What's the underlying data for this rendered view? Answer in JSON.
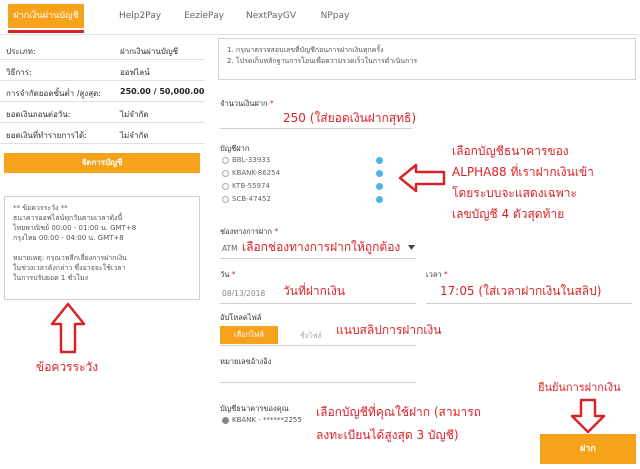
{
  "tabs": [
    {
      "label": "ฝากเงินผ่านบัญชี",
      "active": true
    },
    {
      "label": "Help2Pay",
      "active": false
    },
    {
      "label": "EeziePay",
      "active": false
    },
    {
      "label": "NextPayGV",
      "active": false
    },
    {
      "label": "NPpay",
      "active": false
    }
  ],
  "info": {
    "rows": [
      {
        "label": "ประเภท:",
        "value": "ฝากเงินผ่านบัญชี"
      },
      {
        "label": "วิธีการ:",
        "value": "ออฟไลน์"
      },
      {
        "label": "การจำกัดยอดขั้นต่ำ /สูงสุด:",
        "value": "250.00 / 50,000.00"
      },
      {
        "label": "ยอดเงินถอนต่อวัน:",
        "value": "ไม่จำกัด"
      },
      {
        "label": "ยอดเงินที่ทำรายการได้:",
        "value": "ไม่จำกัด"
      }
    ],
    "manage_button": "จัดการบัญชี"
  },
  "notice": {
    "lines": [
      "** ข้อควรระวัง **",
      "ธนาคารออฟไลน์ทุกวันตามเวลาดังนี้",
      "ไทยพาณิชย์ 00:00 - 01:00 น. GMT+8",
      "กรุงไทย 00:00 - 04:00 น. GMT+8",
      "",
      "หมายเหตุ: กรุณาหลีกเลี่ยงการฝากเงิน",
      "ในช่วงเวลาดังกล่าว ซึ่งอาจจะใช้เวลา",
      "ในการปรับยอด 1 ชั่วโมง"
    ]
  },
  "instructions": [
    "1. กรุณาตรวจสอบเลขที่บัญชีก่อนการฝากเงินทุกครั้ง",
    "2. โปรดเก็บหลักฐานการโอนเพื่อความรวดเร็วในการดำเนินการ"
  ],
  "form": {
    "amount_label": "จำนวนเงินฝาก",
    "required_mark": "*",
    "deposit_account_label": "บัญชีฝาก",
    "accounts": [
      {
        "label": "BBL-33933",
        "selected": false
      },
      {
        "label": "KBANK-86254",
        "selected": false
      },
      {
        "label": "KTB-55974",
        "selected": false
      },
      {
        "label": "SCB-47452",
        "selected": false
      }
    ],
    "channel_label": "ช่องทางการฝาก",
    "channel_value": "ATM",
    "date_label": "วัน",
    "date_value": "08/13/2018",
    "time_label": "เวลา",
    "upload_label": "อัปโหลดไฟล์",
    "upload_button": "เลือกไฟล์",
    "upload_filename": "ชื่อไฟล์",
    "reference_label": "หมายเลขอ้างอิง",
    "your_bank_label": "บัญชีธนาคารของคุณ",
    "your_bank_value": "KBANK - ******2255",
    "deposit_button": "ฝาก"
  },
  "annotations": {
    "amount": "250 (ใส่ยอดเงินฝากสุทธิ)",
    "bank_line1": "เลือกบัญชีธนาคารของ",
    "bank_line2": "ALPHA88 ที่เราฝากเงินเข้า",
    "bank_line3": "โดยระบบจะแสดงเฉพาะ",
    "bank_line4": "เลขบัญชี 4 ตัวสุดท้าย",
    "channel": "เลือกช่องทางการฝากให้ถูกต้อง",
    "date": "วันที่ฝากเงิน",
    "time": "17:05 (ใส่เวลาฝากเงินในสลิป)",
    "upload": "แนบสลิปการฝากเงิน",
    "caution": "ข้อควรระวัง",
    "confirm": "ยืนยันการฝากเงิน",
    "account_line1": "เลือกบัญชีที่คุณใช้ฝาก (สามารถ",
    "account_line2": "ลงทะเบียนได้สูงสุด 3 บัญชี)"
  },
  "colors": {
    "accent": "#f7a21b",
    "annotation": "#d8232a",
    "dot": "#47b5e6"
  }
}
